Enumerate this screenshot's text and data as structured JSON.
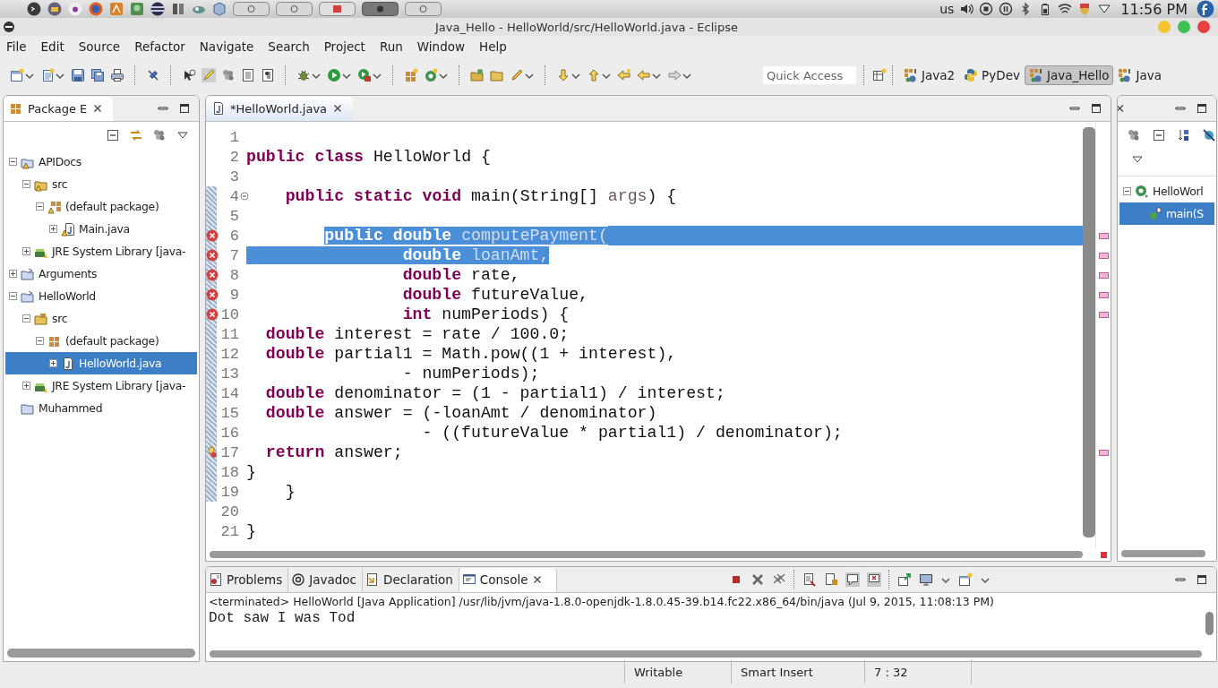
{
  "system_bar": {
    "keyboard": "us",
    "clock": "11:56 PM"
  },
  "window": {
    "title": "Java_Hello - HelloWorld/src/HelloWorld.java - Eclipse"
  },
  "menu": [
    "File",
    "Edit",
    "Source",
    "Refactor",
    "Navigate",
    "Search",
    "Project",
    "Run",
    "Window",
    "Help"
  ],
  "quick_access": {
    "placeholder": "Quick Access"
  },
  "perspectives": [
    {
      "label": "Java2",
      "kind": "java",
      "selected": false
    },
    {
      "label": "PyDev",
      "kind": "python",
      "selected": false
    },
    {
      "label": "Java_Hello",
      "kind": "java",
      "selected": true
    },
    {
      "label": "Java",
      "kind": "java",
      "selected": false
    }
  ],
  "package_explorer": {
    "tab": "Package E",
    "tree": [
      {
        "label": "APIDocs",
        "kind": "project-warn",
        "expanded": true,
        "selected": false,
        "children": [
          {
            "label": "src",
            "kind": "src-warn",
            "expanded": true,
            "selected": false,
            "children": [
              {
                "label": "(default package)",
                "kind": "package-warn",
                "expanded": true,
                "selected": false,
                "children": [
                  {
                    "label": "Main.java",
                    "kind": "file-warn",
                    "expanded": false,
                    "selected": false
                  }
                ]
              }
            ]
          },
          {
            "label": "JRE System Library [java-",
            "kind": "library",
            "expanded": false,
            "selected": false
          }
        ]
      },
      {
        "label": "Arguments",
        "kind": "project",
        "expanded": false,
        "selected": false
      },
      {
        "label": "HelloWorld",
        "kind": "project",
        "expanded": true,
        "selected": false,
        "children": [
          {
            "label": "src",
            "kind": "src",
            "expanded": true,
            "selected": false,
            "children": [
              {
                "label": "(default package)",
                "kind": "package",
                "expanded": true,
                "selected": false,
                "children": [
                  {
                    "label": "HelloWorld.java",
                    "kind": "file",
                    "expanded": false,
                    "selected": true
                  }
                ]
              }
            ]
          },
          {
            "label": "JRE System Library [java-",
            "kind": "library",
            "expanded": false,
            "selected": false
          }
        ]
      },
      {
        "label": "Muhammed",
        "kind": "folder",
        "selected": false
      }
    ]
  },
  "editor": {
    "tabs": [
      {
        "label": "*HelloWorld.java",
        "selected": true
      }
    ],
    "lines": [
      {
        "number": "1",
        "kind": "plain",
        "changed": false,
        "selected_to_end": false
      },
      {
        "number": "2",
        "kind": "plain",
        "changed": false,
        "selected_to_end": false,
        "tokens": [
          {
            "kind": "kw",
            "text": "public",
            "selected": false
          },
          {
            "kind": "kw",
            "text": " class",
            "selected": false
          },
          {
            "kind": "plain",
            "text": " HelloWorld {",
            "selected": false
          }
        ]
      },
      {
        "number": "3",
        "kind": "plain",
        "changed": false,
        "selected_to_end": false
      },
      {
        "number": "4",
        "kind": "fold",
        "changed": true,
        "selected_to_end": false,
        "tokens": [
          {
            "kind": "kw",
            "text": "    public",
            "selected": false
          },
          {
            "kind": "kw",
            "text": " static",
            "selected": false
          },
          {
            "kind": "kw",
            "text": " void",
            "selected": false
          },
          {
            "kind": "plain",
            "text": " main(String[] ",
            "selected": false
          },
          {
            "kind": "param",
            "text": "args",
            "selected": false
          },
          {
            "kind": "plain",
            "text": ") {",
            "selected": false
          }
        ]
      },
      {
        "number": "5",
        "kind": "plain",
        "changed": true,
        "selected_to_end": false
      },
      {
        "number": "6",
        "kind": "error",
        "changed": true,
        "selected_to_end": true,
        "tokens": [
          {
            "kind": "kw",
            "text": "        public",
            "selected": true
          },
          {
            "kind": "kw",
            "text": " double",
            "selected": true
          },
          {
            "kind": "muted",
            "text": " computePayment(",
            "selected": true
          }
        ]
      },
      {
        "number": "7",
        "kind": "error",
        "changed": true,
        "selected_to_end": false,
        "tokens": [
          {
            "kind": "kw",
            "text": "                double",
            "selected": true
          },
          {
            "kind": "muted",
            "text": " loanAmt,",
            "selected": true
          }
        ]
      },
      {
        "number": "8",
        "kind": "error",
        "changed": true,
        "selected_to_end": false,
        "tokens": [
          {
            "kind": "kw",
            "text": "                double",
            "selected": false
          },
          {
            "kind": "plain",
            "text": " rate,",
            "selected": false
          }
        ]
      },
      {
        "number": "9",
        "kind": "error",
        "changed": true,
        "selected_to_end": false,
        "tokens": [
          {
            "kind": "kw",
            "text": "                double",
            "selected": false
          },
          {
            "kind": "plain",
            "text": " futureValue,",
            "selected": false
          }
        ]
      },
      {
        "number": "10",
        "kind": "error",
        "changed": true,
        "selected_to_end": false,
        "tokens": [
          {
            "kind": "kw",
            "text": "                int",
            "selected": false
          },
          {
            "kind": "plain",
            "text": " numPeriods) {",
            "selected": false
          }
        ]
      },
      {
        "number": "11",
        "kind": "plain",
        "changed": true,
        "selected_to_end": false,
        "tokens": [
          {
            "kind": "kw",
            "text": "  double",
            "selected": false
          },
          {
            "kind": "plain",
            "text": " interest = rate / 100.0;",
            "selected": false
          }
        ]
      },
      {
        "number": "12",
        "kind": "plain",
        "changed": true,
        "selected_to_end": false,
        "tokens": [
          {
            "kind": "kw",
            "text": "  double",
            "selected": false
          },
          {
            "kind": "plain",
            "text": " partial1 = Math.pow((1 + interest),",
            "selected": false
          }
        ]
      },
      {
        "number": "13",
        "kind": "plain",
        "changed": true,
        "selected_to_end": false,
        "tokens": [
          {
            "kind": "plain",
            "text": "                - numPeriods);",
            "selected": false
          }
        ]
      },
      {
        "number": "14",
        "kind": "plain",
        "changed": true,
        "selected_to_end": false,
        "tokens": [
          {
            "kind": "kw",
            "text": "  double",
            "selected": false
          },
          {
            "kind": "plain",
            "text": " denominator = (1 - partial1) / interest;",
            "selected": false
          }
        ]
      },
      {
        "number": "15",
        "kind": "plain",
        "changed": true,
        "selected_to_end": false,
        "tokens": [
          {
            "kind": "kw",
            "text": "  double",
            "selected": false
          },
          {
            "kind": "plain",
            "text": " answer = (-loanAmt / denominator)",
            "selected": false
          }
        ]
      },
      {
        "number": "16",
        "kind": "plain",
        "changed": true,
        "selected_to_end": false,
        "tokens": [
          {
            "kind": "plain",
            "text": "                  - ((futureValue * partial1) / denominator);",
            "selected": false
          }
        ]
      },
      {
        "number": "17",
        "kind": "quickfix",
        "changed": true,
        "selected_to_end": false,
        "tokens": [
          {
            "kind": "kw",
            "text": "  return",
            "selected": false
          },
          {
            "kind": "plain",
            "text": " answer;",
            "selected": false
          }
        ]
      },
      {
        "number": "18",
        "kind": "plain",
        "changed": true,
        "selected_to_end": false,
        "tokens": [
          {
            "kind": "plain",
            "text": "}",
            "selected": false
          }
        ]
      },
      {
        "number": "19",
        "kind": "plain",
        "changed": true,
        "selected_to_end": false,
        "tokens": [
          {
            "kind": "plain",
            "text": "    }",
            "selected": false
          }
        ]
      },
      {
        "number": "20",
        "kind": "plain",
        "changed": false,
        "selected_to_end": false
      },
      {
        "number": "21",
        "kind": "plain",
        "changed": false,
        "selected_to_end": false,
        "tokens": [
          {
            "kind": "plain",
            "text": "}",
            "selected": false
          }
        ]
      }
    ]
  },
  "outline": {
    "tree": [
      {
        "label": "HelloWorl",
        "kind": "class",
        "expanded": true,
        "selected": false,
        "children": [
          {
            "label": "main(S",
            "kind": "method",
            "selected": true
          }
        ]
      }
    ]
  },
  "console": {
    "tabs": [
      {
        "label": "Problems",
        "kind": "problems",
        "selected": false
      },
      {
        "label": "Javadoc",
        "kind": "javadoc",
        "selected": false
      },
      {
        "label": "Declaration",
        "kind": "declaration",
        "selected": false
      },
      {
        "label": "Console",
        "kind": "console",
        "selected": true
      }
    ],
    "header": "<terminated> HelloWorld [Java Application] /usr/lib/jvm/java-1.8.0-openjdk-1.8.0.45-39.b14.fc22.x86_64/bin/java (Jul 9, 2015, 11:08:13 PM)",
    "output": "Dot saw I was Tod"
  },
  "status_bar": [
    "Writable",
    "Smart Insert",
    "7 : 32"
  ]
}
